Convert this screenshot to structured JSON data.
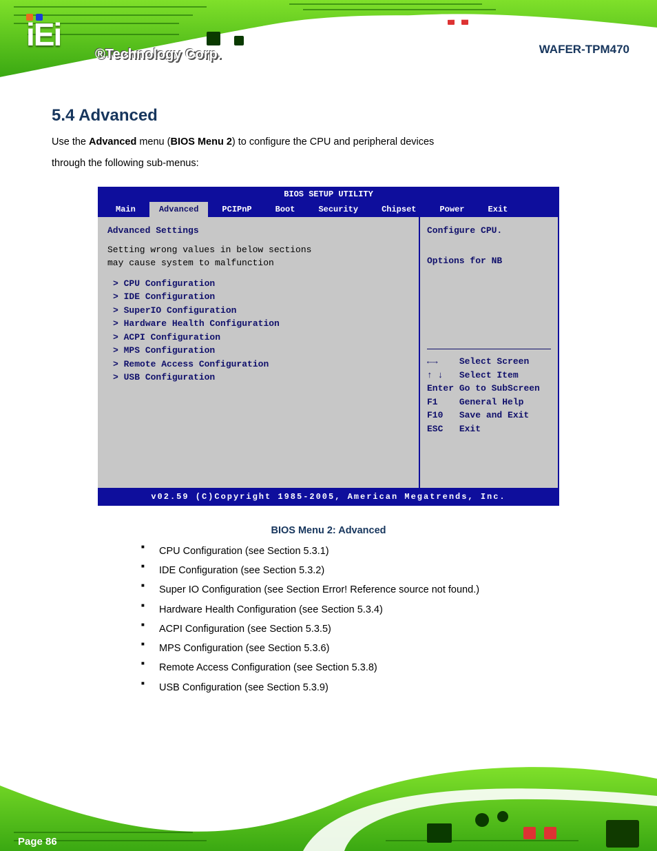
{
  "header": {
    "logo_text": "iEi",
    "logo_tagline": "®Technology Corp.",
    "product_title": "WAFER-TPM470"
  },
  "section": {
    "title": "5.4 Advanced",
    "intro_1": "Use the ",
    "intro_bold": "Advanced",
    "intro_2": " menu (",
    "intro_link": "BIOS Menu 2",
    "intro_3": ") to configure the CPU and peripheral devices",
    "intro_4": "through the following sub-menus:"
  },
  "bios": {
    "top_bar": "BIOS SETUP UTILITY",
    "tabs": [
      "Main",
      "Advanced",
      "PCIPnP",
      "Boot",
      "Security",
      "Chipset",
      "Power",
      "Exit"
    ],
    "active_tab": 1,
    "warning_line1": "Setting wrong values in below sections",
    "warning_line2": "may cause system to malfunction",
    "menu_header": "Advanced Settings",
    "items": {
      "cpu": "CPU Configuration",
      "ide": "IDE Configuration",
      "superio": "SuperIO Configuration",
      "hw": "Hardware Health Configuration",
      "acpi": "ACPI Configuration",
      "mps": "MPS Configuration",
      "remote": "Remote Access Configuration",
      "usb": "USB Configuration"
    },
    "right_help_line1": "Configure CPU.",
    "right_help_line2": "Options for NB",
    "nav": {
      "lr": "Select Screen",
      "ud": "Select Item",
      "enter_key": "Enter",
      "enter_txt": "Go to SubScreen",
      "f1_key": "F1",
      "f1_txt": "General Help",
      "f10_key": "F10",
      "f10_txt": "Save and Exit",
      "esc_key": "ESC",
      "esc_txt": "Exit"
    },
    "bottom_bar": "v02.59 (C)Copyright 1985-2005, American Megatrends, Inc."
  },
  "figure_caption": "BIOS Menu 2: Advanced",
  "bullets": [
    "CPU Configuration (see Section 5.3.1)",
    "IDE Configuration (see Section 5.3.2)",
    "Super IO Configuration (see Section Error! Reference source not found.)",
    "Hardware Health Configuration (see Section 5.3.4)",
    "ACPI Configuration (see Section 5.3.5)",
    "MPS Configuration (see Section 5.3.6)",
    "Remote Access Configuration (see Section 5.3.8)",
    "USB Configuration (see Section 5.3.9)"
  ],
  "page_number": "Page 86"
}
